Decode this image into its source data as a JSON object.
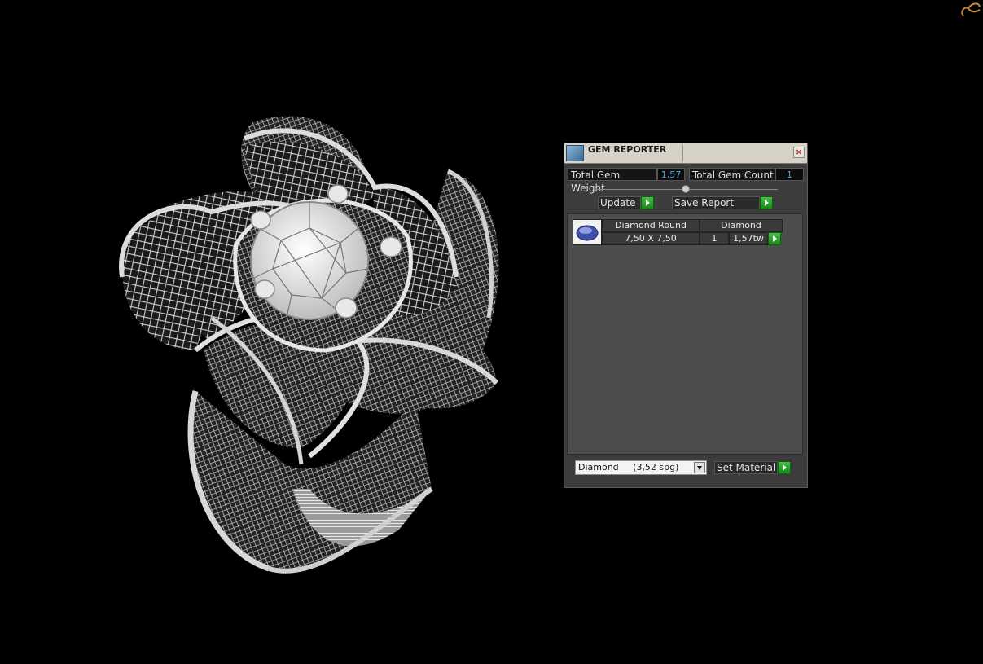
{
  "window": {
    "title": "GEM REPORTER",
    "close_glyph": "×"
  },
  "stats": {
    "total_weight_label": "Total Gem Weight",
    "total_weight_value": "1,57",
    "total_count_label": "Total Gem Count",
    "total_count_value": "1"
  },
  "actions": {
    "update_label": "Update",
    "save_report_label": "Save Report",
    "set_material_label": "Set Material"
  },
  "gem_list": {
    "header_shape": "Diamond Round",
    "header_material": "Diamond",
    "rows": [
      {
        "size": "7,50 X 7,50",
        "count": "1",
        "weight": "1,57tw"
      }
    ]
  },
  "material_select": {
    "value": "Diamond     (3,52 spg)"
  },
  "colors": {
    "panel_bg": "#3c3c3c",
    "titlebar_bg": "#d6d2c8",
    "accent_green": "#2aa52a",
    "value_blue": "#4fa7d8",
    "viewport_bg": "#000000"
  },
  "icons": {
    "title": "gem-reporter-app-icon",
    "close": "close-icon",
    "go": "play-arrow-icon",
    "thumb": "round-gem-icon",
    "dropdown": "chevron-down-icon",
    "corner": "cursor-hand-icon"
  }
}
